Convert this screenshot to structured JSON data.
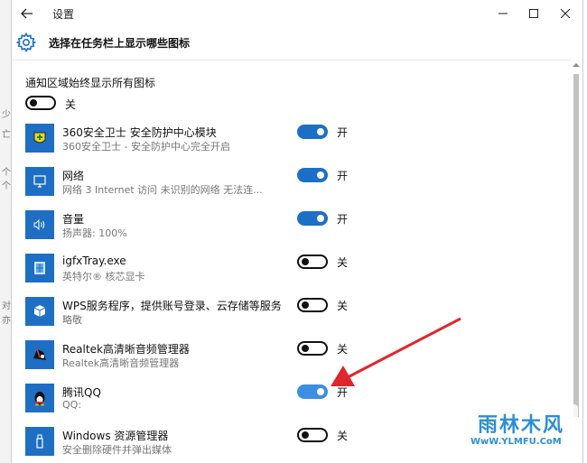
{
  "window": {
    "title": "设置",
    "page_title": "选择在任务栏上显示哪些图标"
  },
  "always_show": {
    "label": "通知区域始终显示所有图标",
    "state": "关",
    "on": false
  },
  "apps": [
    {
      "name": "360安全卫士 安全防护中心模块",
      "desc": "360安全卫士 - 安全防护中心完全开启",
      "state": "开",
      "on": true,
      "icon": "shield-360-icon"
    },
    {
      "name": "网络",
      "desc": "网络  3 Internet 访问  未识别的网络 无法连...",
      "state": "开",
      "on": true,
      "icon": "network-icon"
    },
    {
      "name": "音量",
      "desc": "扬声器: 100%",
      "state": "开",
      "on": true,
      "icon": "speaker-icon"
    },
    {
      "name": "igfxTray.exe",
      "desc": "英特尔® 核芯显卡",
      "state": "关",
      "on": false,
      "icon": "intel-graphics-icon"
    },
    {
      "name": "WPS服务程序，提供账号登录、云存储等服务",
      "desc": "略敬",
      "state": "关",
      "on": false,
      "icon": "wps-cube-icon"
    },
    {
      "name": "Realtek高清晰音频管理器",
      "desc": "Realtek高清晰音频管理器",
      "state": "关",
      "on": false,
      "icon": "realtek-speaker-icon"
    },
    {
      "name": "腾讯QQ",
      "desc": "QQ:",
      "state": "开",
      "on": true,
      "icon": "qq-penguin-icon"
    },
    {
      "name": "Windows 资源管理器",
      "desc": "安全删除硬件并弹出媒体",
      "state": "关",
      "on": false,
      "icon": "usb-drive-icon"
    }
  ],
  "watermark": {
    "main": "雨林木风",
    "sub": "WwW.YLMFU.CoM"
  },
  "colors": {
    "accent": "#1c6fc7",
    "icon_bg": "#1e6fc4",
    "annotation_arrow": "#e0262d"
  }
}
